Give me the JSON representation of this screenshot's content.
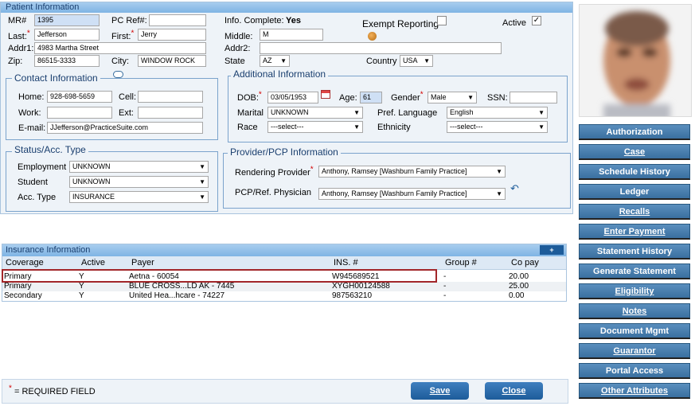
{
  "patient_panel": {
    "title": "Patient Information",
    "mr_label": "MR#",
    "mr_value": "1395",
    "pc_ref_label": "PC Ref#:",
    "pc_ref_value": "",
    "info_complete_label": "Info. Complete:",
    "info_complete_value": "Yes",
    "exempt_label": "Exempt Reporting",
    "active_label": "Active",
    "active_check": "✓",
    "last_label": "Last:",
    "last_value": "Jefferson",
    "first_label": "First:",
    "first_value": "Jerry",
    "middle_label": "Middle:",
    "middle_value": "M",
    "addr1_label": "Addr1:",
    "addr1_value": "4983 Martha Street",
    "addr2_label": "Addr2:",
    "addr2_value": "",
    "zip_label": "Zip:",
    "zip_value": "86515-3333",
    "city_label": "City:",
    "city_value": "WINDOW ROCK",
    "state_label": "State",
    "state_value": "AZ",
    "country_label": "Country",
    "country_value": "USA",
    "required_star": "*"
  },
  "contact": {
    "legend": "Contact Information",
    "home_label": "Home:",
    "home_value": "928-698-5659",
    "cell_label": "Cell:",
    "cell_value": "",
    "work_label": "Work:",
    "work_value": "",
    "ext_label": "Ext:",
    "ext_value": "",
    "email_label": "E-mail:",
    "email_value": "JJefferson@PracticeSuite.com"
  },
  "additional": {
    "legend": "Additional Information",
    "dob_label": "DOB:",
    "dob_value": "03/05/1953",
    "age_label": "Age:",
    "age_value": "61",
    "gender_label": "Gender",
    "gender_value": "Male",
    "ssn_label": "SSN:",
    "ssn_value": "",
    "marital_label": "Marital",
    "marital_value": "UNKNOWN",
    "pref_lang_label": "Pref. Language",
    "pref_lang_value": "English",
    "race_label": "Race",
    "race_value": "---select---",
    "ethnicity_label": "Ethnicity",
    "ethnicity_value": "---select---"
  },
  "status": {
    "legend": "Status/Acc. Type",
    "employment_label": "Employment",
    "employment_value": "UNKNOWN",
    "student_label": "Student",
    "student_value": "UNKNOWN",
    "acc_type_label": "Acc. Type",
    "acc_type_value": "INSURANCE"
  },
  "provider": {
    "legend": "Provider/PCP Information",
    "rendering_label": "Rendering Provider",
    "rendering_value": "Anthony, Ramsey [Washburn Family Practice]",
    "pcp_label": "PCP/Ref. Physician",
    "pcp_value": "Anthony, Ramsey [Washburn Family Practice]"
  },
  "insurance": {
    "title": "Insurance Information",
    "add_label": "+",
    "columns": [
      "Coverage",
      "Active",
      "Payer",
      "INS. #",
      "Group #",
      "Co pay"
    ],
    "rows": [
      [
        "Primary",
        "Y",
        "Aetna - 60054",
        "W945689521",
        "-",
        "20.00"
      ],
      [
        "Primary",
        "Y",
        "BLUE CROSS...LD AK - 7445",
        "XYGH00124588",
        "-",
        "25.00"
      ],
      [
        "Secondary",
        "Y",
        "United Hea...hcare - 74227",
        "987563210",
        "-",
        "0.00"
      ]
    ]
  },
  "footer": {
    "required_note": "= REQUIRED FIELD",
    "required_star": "*",
    "save_label": "Save",
    "close_label": "Close"
  },
  "sidebar": {
    "buttons": [
      "Authorization",
      "Case",
      "Schedule History",
      "Ledger",
      "Recalls",
      "Enter Payment",
      "Statement History",
      "Generate Statement",
      "Eligibility",
      "Notes",
      "Document Mgmt",
      "Guarantor",
      "Portal Access",
      "Other Attributes"
    ]
  },
  "colors": {
    "accent": "#1d5c9a",
    "header": "#7fb4e4",
    "highlight_border": "#a2272a",
    "required": "#d20000"
  }
}
